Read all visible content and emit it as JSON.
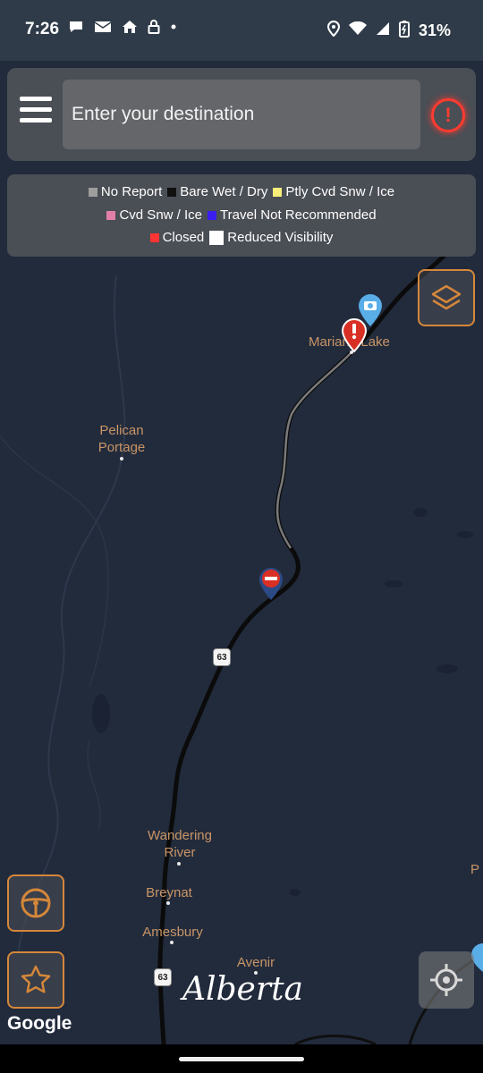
{
  "status_bar": {
    "time": "7:26",
    "battery": "31%",
    "left_icons": [
      "chat-icon",
      "outlook-icon",
      "home-icon",
      "lock-icon",
      "dot-icon"
    ],
    "right_icons": [
      "location-icon",
      "wifi-icon",
      "signal-icon",
      "battery-icon"
    ]
  },
  "search": {
    "placeholder": "Enter your destination"
  },
  "legend": {
    "rows": [
      [
        {
          "label": "No Report",
          "color": "#9e9e9e"
        },
        {
          "label": "Bare Wet / Dry",
          "color": "#111111"
        },
        {
          "label": "Ptly Cvd Snw / Ice",
          "color": "#f7ef7a"
        }
      ],
      [
        {
          "label": "Cvd Snw / Ice",
          "color": "#e07fa8"
        },
        {
          "label": "Travel Not Recommended",
          "color": "#3a1df0"
        }
      ],
      [
        {
          "label": "Closed",
          "color": "#ff3333"
        },
        {
          "label": "Reduced Visibility",
          "color": "#ffffff"
        }
      ]
    ]
  },
  "map": {
    "places": {
      "pelican": "Pelican\nPortage",
      "mariana": "Mariana Lake",
      "wandering": "Wandering\nRiver",
      "breynat": "Breynat",
      "amesbury": "Amesbury",
      "avenir": "Avenir",
      "edge_p": "P"
    },
    "shields": {
      "top": "63",
      "middle": "63",
      "bottom": "63"
    }
  },
  "branding": {
    "alberta": "Alberta",
    "google": "Google"
  },
  "colors": {
    "accent_orange": "#d5873a",
    "alert_red": "#ff3b30",
    "map_bg": "#222b3c"
  }
}
